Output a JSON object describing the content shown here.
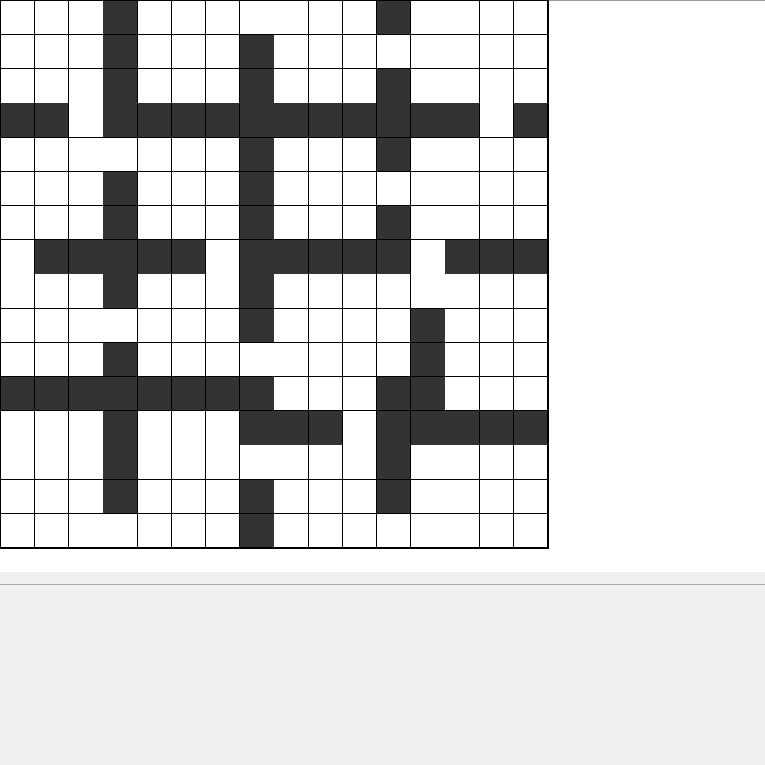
{
  "puzzle": {
    "rows": 16,
    "cols": 16,
    "colors": {
      "block": "#333333",
      "open": "#ffffff",
      "line": "#000000",
      "panel": "#f0f0f0"
    },
    "layout": [
      "...#.......#....",
      "...#...#........",
      "...#...#...#....",
      "##.###########.#",
      ".......#...#....",
      "...#...#........",
      "...#...#...#....",
      ".#####.#####.###",
      "...#...#........",
      ".......#....#...",
      "...#........#...",
      "########...##...",
      "...#...###.#####",
      "...#.......#....",
      "...#...#...#....",
      ".......#........"
    ]
  }
}
